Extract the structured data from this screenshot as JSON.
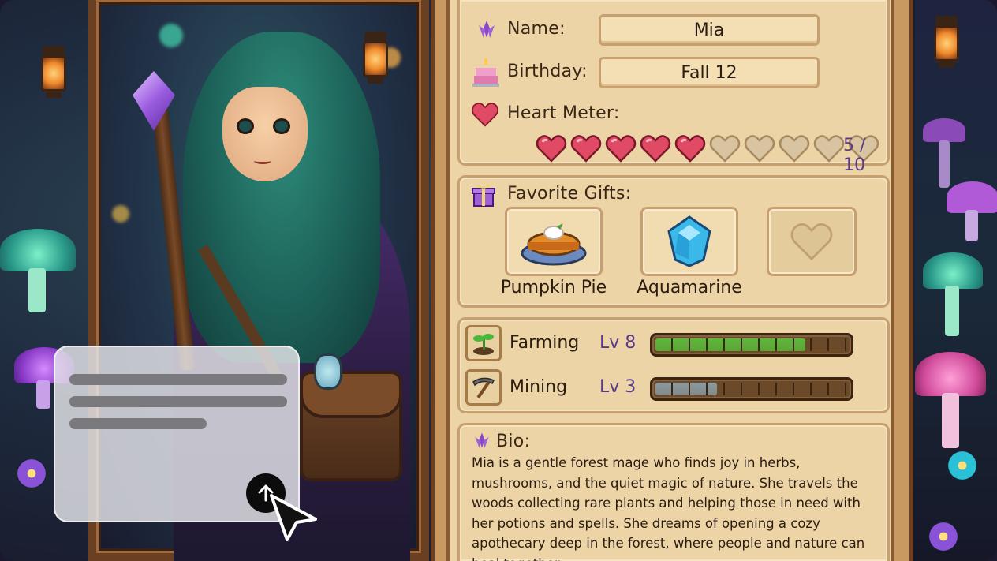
{
  "character": {
    "name_label": "Name:",
    "name": "Mia",
    "birthday_label": "Birthday:",
    "birthday": "Fall 12",
    "heart_label": "Heart Meter:",
    "hearts_filled": 5,
    "hearts_total": 10,
    "heart_value": "5 / 10"
  },
  "gifts": {
    "label": "Favorite Gifts:",
    "items": [
      {
        "name": "Pumpkin Pie",
        "icon": "pumpkin-pie-icon"
      },
      {
        "name": "Aquamarine",
        "icon": "aquamarine-gem-icon"
      },
      {
        "name": "",
        "icon": "empty-heart-slot-icon"
      }
    ]
  },
  "skills": [
    {
      "name": "Farming",
      "level": "Lv 8",
      "progress": 0.78,
      "icon": "sprout-icon",
      "color": "#5cb83a"
    },
    {
      "name": "Mining",
      "level": "Lv 3",
      "progress": 0.32,
      "icon": "pickaxe-icon",
      "color": "#8a9aa0"
    }
  ],
  "bio": {
    "label": "Bio:",
    "text": "Mia is a gentle forest mage who finds joy in herbs, mushrooms, and the quiet magic of nature. She travels the woods collecting rare plants and helping those in need with her potions and spells. She dreams of opening a cozy apothecary deep in the forest, where people and nature can heal together."
  },
  "colors": {
    "panel_bg": "#ecd4a6",
    "frame_wood": "#6b3f22",
    "heart_full": "#e04a64",
    "heart_empty": "#d8c4a0",
    "accent_purple": "#5a3a8a"
  }
}
